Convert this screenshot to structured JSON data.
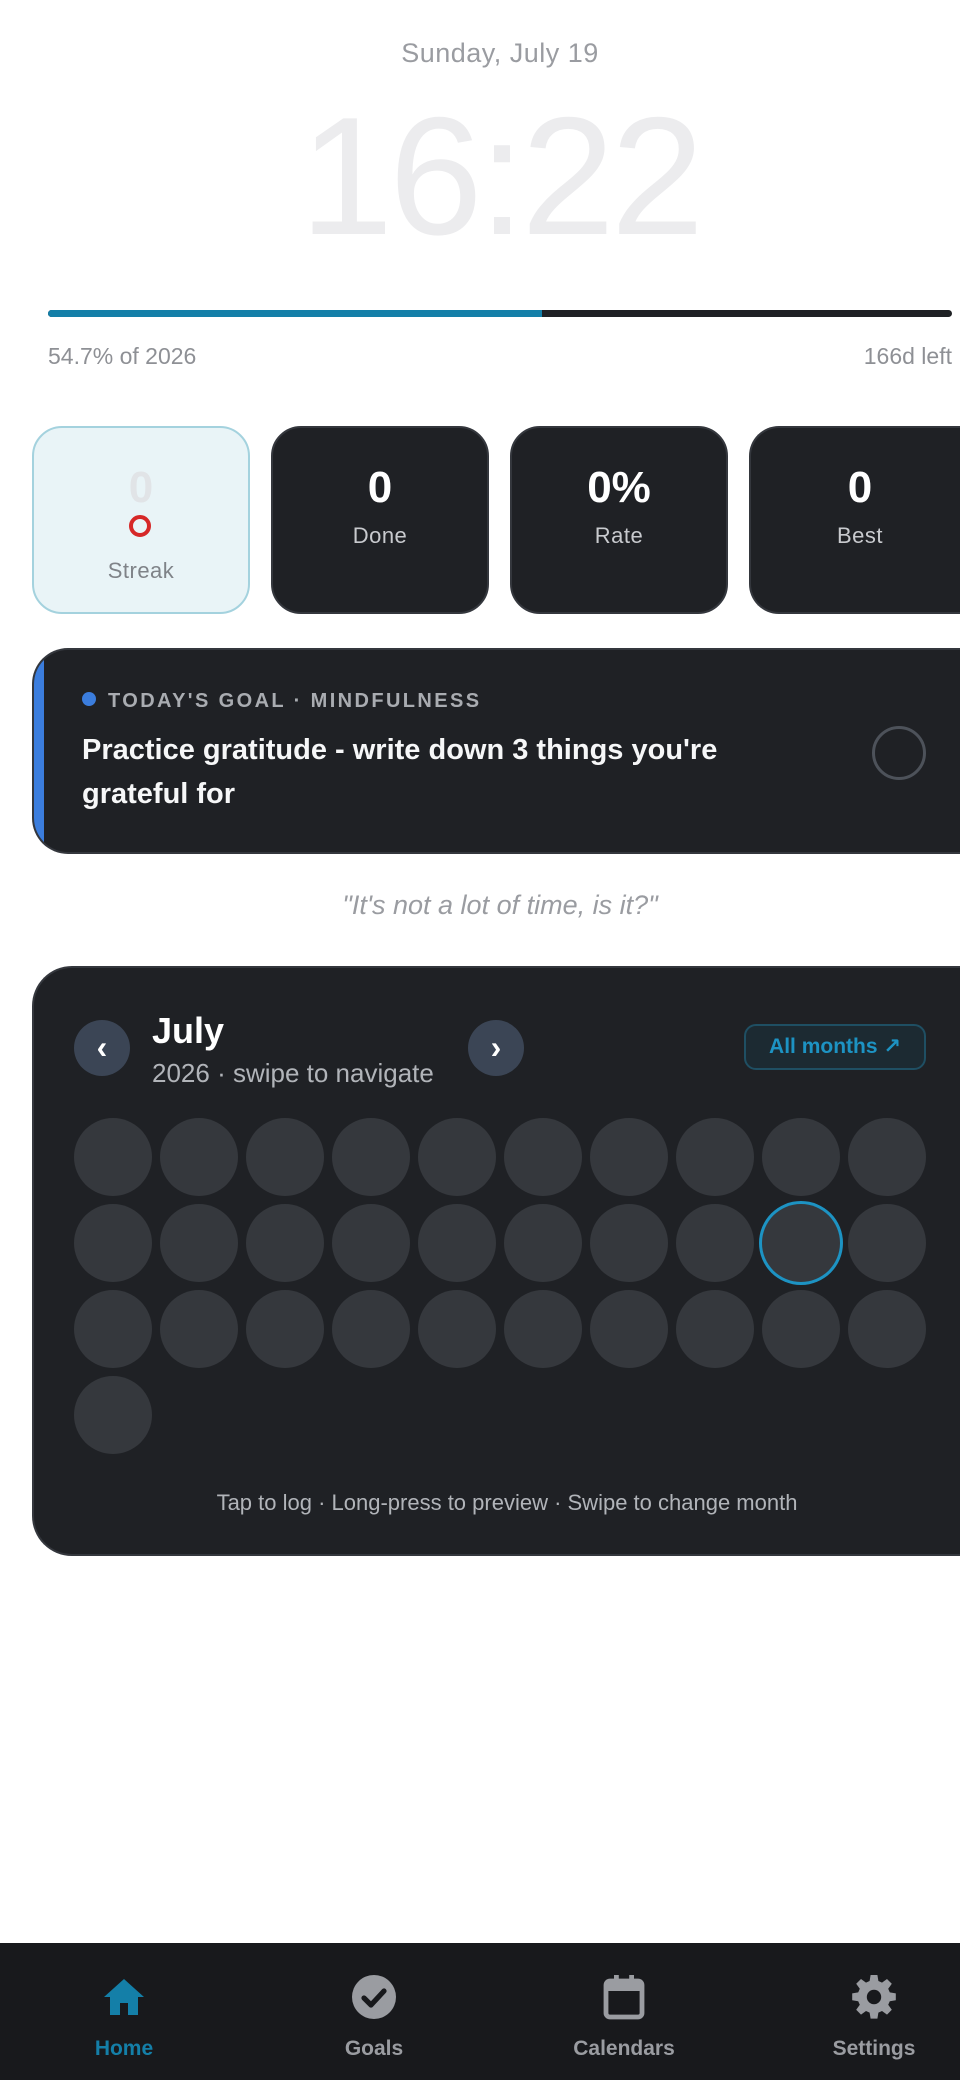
{
  "header": {
    "date": "Sunday, July 19",
    "time": "16:22"
  },
  "year_progress": {
    "fraction": 0.547,
    "label": "54.7% of 2026",
    "remaining": "166d left"
  },
  "stats": [
    {
      "value": "0",
      "label": "Streak"
    },
    {
      "value": "0",
      "label": "Done"
    },
    {
      "value": "0%",
      "label": "Rate"
    },
    {
      "value": "0",
      "label": "Best"
    }
  ],
  "goal": {
    "heading": "TODAY'S GOAL · MINDFULNESS",
    "text": "Practice gratitude - write down 3 things you're grateful for"
  },
  "quote": "\"It's not a lot of time, is it?\"",
  "calendar": {
    "prev_label": "‹",
    "next_label": "›",
    "month": "July",
    "subtitle": "2026 · swipe to navigate",
    "all_months": "All months ↗",
    "day_count": 31,
    "today_index": 18,
    "hint": "Tap to log · Long-press to preview · Swipe to change month"
  },
  "tabs": [
    {
      "label": "Home",
      "icon": "home-icon",
      "active": true
    },
    {
      "label": "Goals",
      "icon": "check-circle-icon",
      "active": false
    },
    {
      "label": "Calendars",
      "icon": "calendar-icon",
      "active": false
    },
    {
      "label": "Settings",
      "icon": "gear-icon",
      "active": false
    }
  ],
  "colors": {
    "accent": "#147fa8",
    "card_bg": "#1f2125",
    "goal_accent": "#3b7ddd",
    "streak_ring": "#d62828"
  }
}
